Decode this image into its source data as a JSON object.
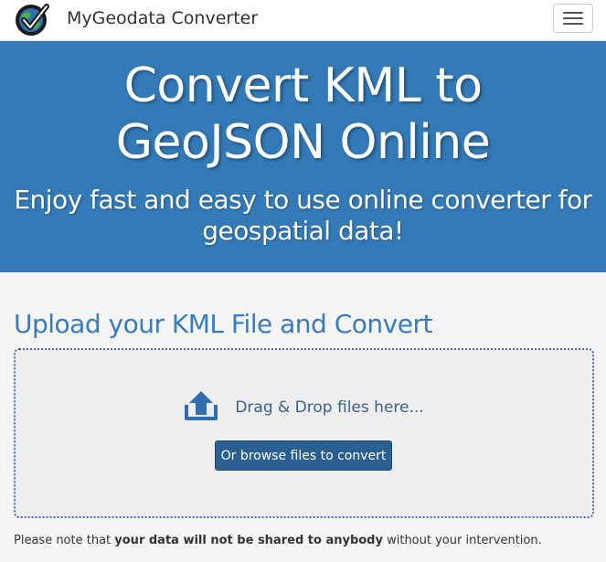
{
  "header": {
    "brand": "MyGeodata Converter",
    "logo_icon": "globe-check-icon",
    "menu_icon": "hamburger-menu-icon"
  },
  "hero": {
    "title_line1": "Convert KML to",
    "title_line2": "GeoJSON Online",
    "subtitle_line1": "Enjoy fast and easy to use online converter for",
    "subtitle_line2": "geospatial data!"
  },
  "upload": {
    "title": "Upload your KML File and Convert",
    "drop_text": "Drag & Drop files here...",
    "browse_label": "Or browse files to convert",
    "upload_icon": "upload-icon"
  },
  "note": {
    "prefix": "Please note that ",
    "emphasis": "your data will not be shared to anybody",
    "suffix": " without your intervention."
  },
  "colors": {
    "hero_bg": "#337ab7",
    "accent": "#3a7bbf",
    "button": "#2b5f90"
  }
}
